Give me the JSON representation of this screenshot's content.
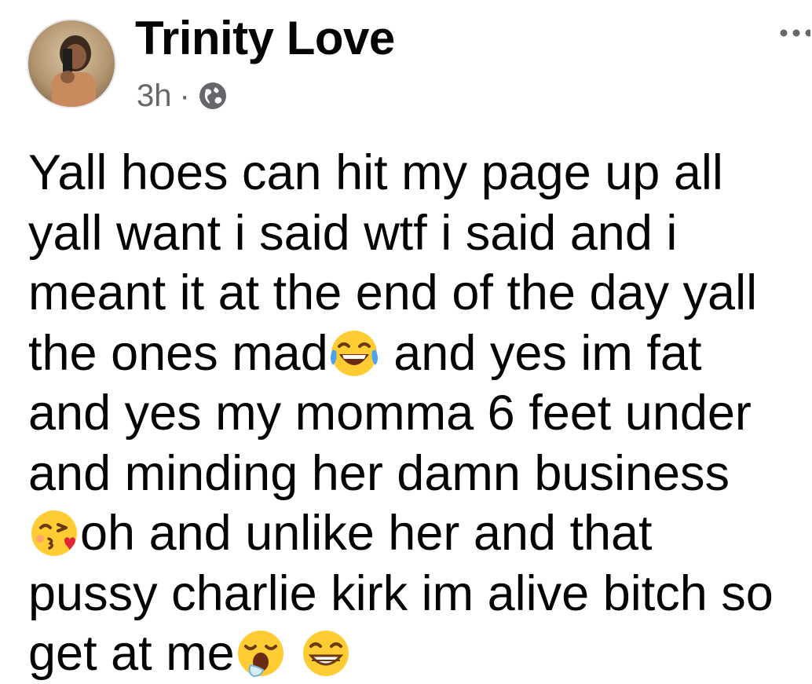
{
  "post": {
    "author": "Trinity Love",
    "time": "3h",
    "separator": "·",
    "privacy_icon": "globe-icon",
    "more_icon": "more-options-icon",
    "lines": [
      "Yall hoes can hit my page up all",
      "yall want i said wtf i said and i",
      "meant it at the end of the day yall",
      "the ones mad",
      " and yes im fat",
      "and yes my momma 6 feet under",
      "and minding her damn business",
      "oh and unlike her and that",
      "pussy charlie kirk im alive bitch so",
      "get at me"
    ],
    "emojis": [
      "face-with-tears-of-joy-emoji",
      "face-blowing-a-kiss-emoji",
      "yawning-face-emoji",
      "beaming-face-emoji"
    ]
  }
}
